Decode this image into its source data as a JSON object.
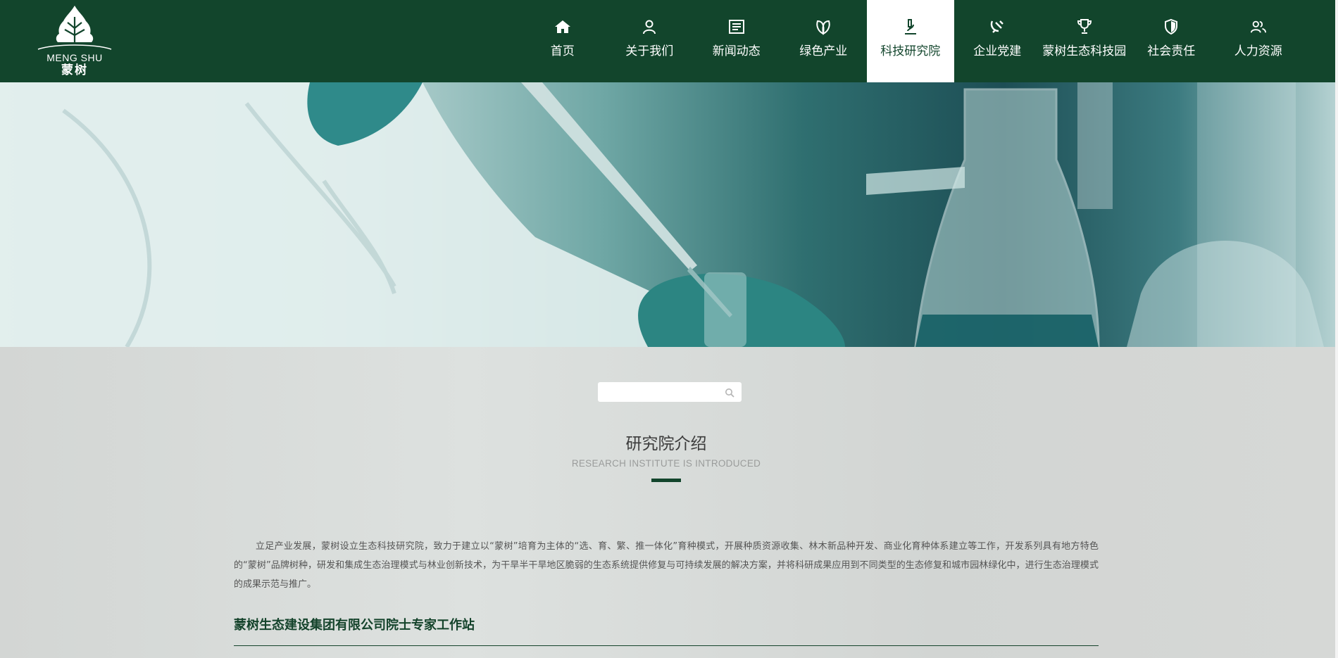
{
  "logo": {
    "text_en": "MENG SHU",
    "text_cn": "蒙树",
    "icon": "tree-leaf-logo-icon"
  },
  "nav": {
    "items": [
      {
        "label": "首页",
        "icon": "home-icon",
        "active": false
      },
      {
        "label": "关于我们",
        "icon": "user-icon",
        "active": false
      },
      {
        "label": "新闻动态",
        "icon": "newspaper-icon",
        "active": false
      },
      {
        "label": "绿色产业",
        "icon": "leaf-icon",
        "active": false
      },
      {
        "label": "科技研究院",
        "icon": "microscope-icon",
        "active": true
      },
      {
        "label": "企业党建",
        "icon": "party-emblem-icon",
        "active": false
      },
      {
        "label": "蒙树生态科技园",
        "icon": "trophy-icon",
        "active": false
      },
      {
        "label": "社会责任",
        "icon": "shield-icon",
        "active": false
      },
      {
        "label": "人力资源",
        "icon": "users-icon",
        "active": false
      }
    ],
    "active_color": "#12452c"
  },
  "search": {
    "value": "",
    "placeholder": "",
    "icon": "search-icon"
  },
  "section": {
    "title": "研究院介绍",
    "subtitle": "RESEARCH INSTITUTE IS INTRODUCED"
  },
  "intro": {
    "text": "立足产业发展，蒙树设立生态科技研究院，致力于建立以“蒙树”培育为主体的“选、育、繁、推一体化”育种模式，开展种质资源收集、林木新品种开发、商业化育种体系建立等工作，开发系列具有地方特色的“蒙树”品牌树种，研发和集成生态治理模式与林业创新技术，为干旱半干旱地区脆弱的生态系统提供修复与可持续发展的解决方案，并将科研成果应用到不同类型的生态修复和城市园林绿化中，进行生态治理模式的成果示范与推广。"
  },
  "station": {
    "title": "蒙树生态建设集团有限公司院士专家工作站"
  },
  "colors": {
    "header_bg": "#12452c",
    "accent": "#12452c",
    "content_bg": "#d6d9d7"
  }
}
